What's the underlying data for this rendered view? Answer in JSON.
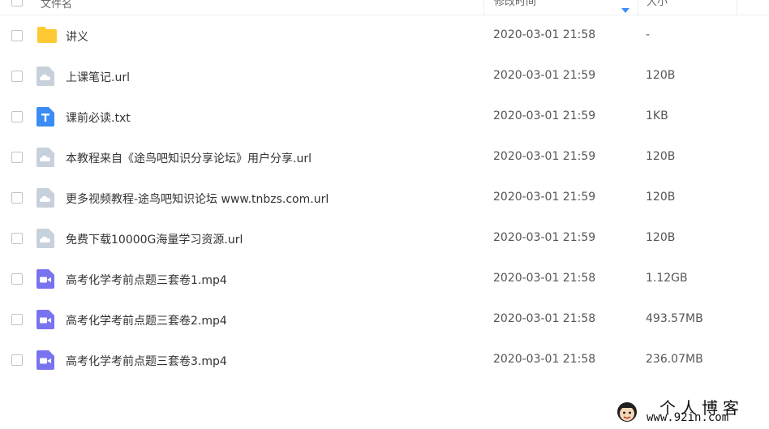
{
  "header": {
    "name_label": "文件名",
    "time_label": "修改时间",
    "size_label": "大小"
  },
  "files": [
    {
      "icon": "folder-icon",
      "name": "讲义",
      "time": "2020-03-01 21:58",
      "size": "-"
    },
    {
      "icon": "url-file-icon",
      "name": "上课笔记.url",
      "time": "2020-03-01 21:59",
      "size": "120B"
    },
    {
      "icon": "txt-file-icon",
      "name": "课前必读.txt",
      "time": "2020-03-01 21:59",
      "size": "1KB"
    },
    {
      "icon": "url-file-icon",
      "name": "本教程来自《途鸟吧知识分享论坛》用户分享.url",
      "time": "2020-03-01 21:59",
      "size": "120B"
    },
    {
      "icon": "url-file-icon",
      "name": "更多视频教程-途鸟吧知识论坛 www.tnbzs.com.url",
      "time": "2020-03-01 21:59",
      "size": "120B"
    },
    {
      "icon": "url-file-icon",
      "name": "免费下载10000G海量学习资源.url",
      "time": "2020-03-01 21:59",
      "size": "120B"
    },
    {
      "icon": "video-file-icon",
      "name": "高考化学考前点题三套卷1.mp4",
      "time": "2020-03-01 21:58",
      "size": "1.12GB"
    },
    {
      "icon": "video-file-icon",
      "name": "高考化学考前点题三套卷2.mp4",
      "time": "2020-03-01 21:58",
      "size": "493.57MB"
    },
    {
      "icon": "video-file-icon",
      "name": "高考化学考前点题三套卷3.mp4",
      "time": "2020-03-01 21:58",
      "size": "236.07MB"
    }
  ],
  "watermark": {
    "title": "个人博客",
    "url": "www.92in.com"
  },
  "colors": {
    "folder": "#ffc933",
    "url_file": "#c7d1db",
    "txt_file": "#3a8cf6",
    "video_file": "#7a73f0",
    "sort_arrow": "#3a8cf6"
  }
}
